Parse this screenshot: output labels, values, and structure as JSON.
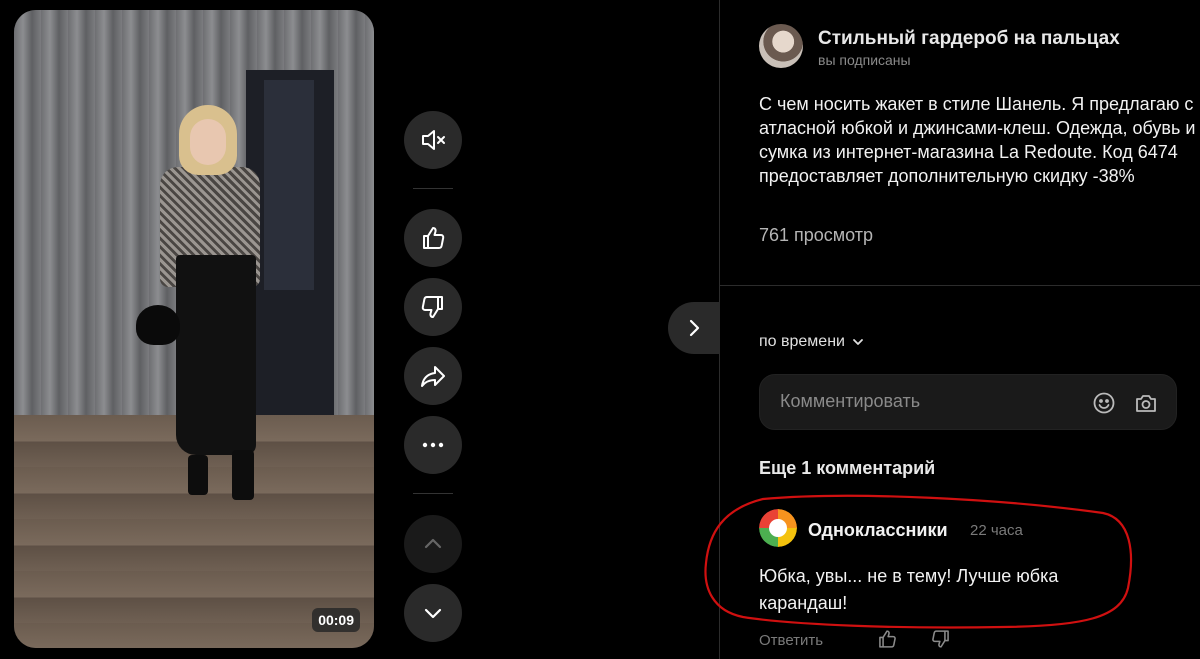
{
  "video": {
    "duration": "00:09"
  },
  "controls": {
    "mute_icon": "volume-muted-icon",
    "like_icon": "thumbs-up-icon",
    "dislike_icon": "thumbs-down-icon",
    "share_icon": "share-arrow-icon",
    "more_icon": "more-dots-icon",
    "prev_icon": "chevron-up-icon",
    "next_icon": "chevron-down-icon"
  },
  "channel": {
    "name": "Стильный гардероб на пальцах",
    "status": "вы подписаны"
  },
  "post": {
    "description": "С чем носить жакет в стиле Шанель. Я предлагаю с атласной юбкой и джинсами-клеш. Одежда, обувь и сумка из интернет-магазина La Redoute. Код 6474 предоставляет дополнительную скидку -38%",
    "views": "761 просмотр"
  },
  "comments": {
    "sort_label": "по времени",
    "input_placeholder": "Комментировать",
    "more_label": "Еще 1 комментарий",
    "items": [
      {
        "author": "Одноклассники",
        "time": "22 часа",
        "text": "Юбка, увы... не в тему! Лучше юбка карандаш!",
        "reply_label": "Ответить"
      }
    ]
  },
  "colors": {
    "background": "#000000",
    "button_bg": "#2a2a2a",
    "highlight": "#d01010"
  }
}
